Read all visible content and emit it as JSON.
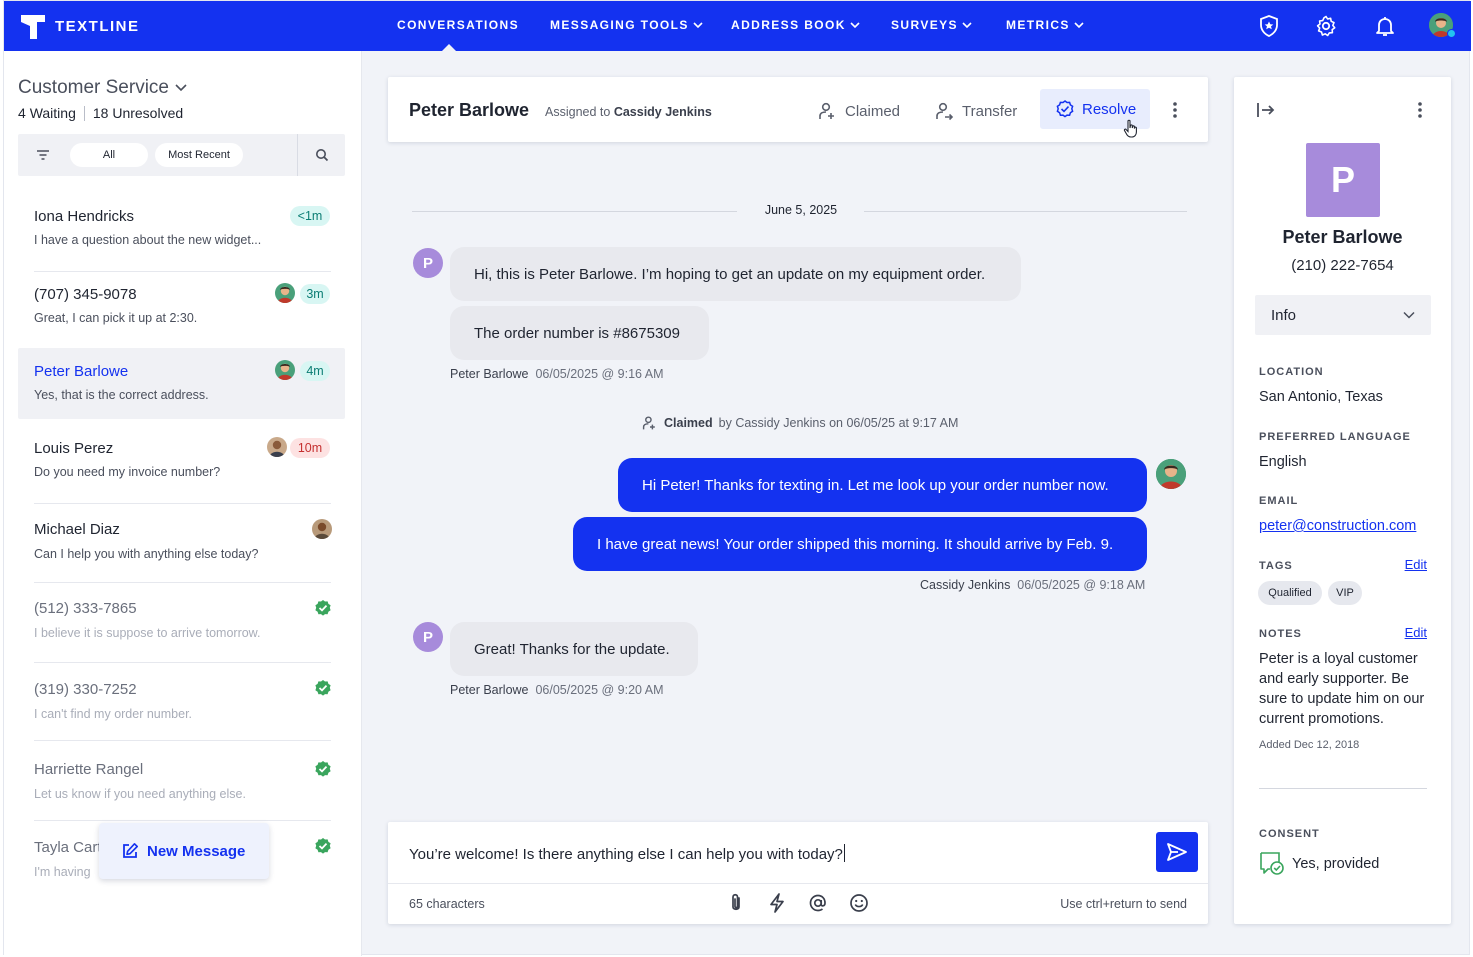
{
  "brand": {
    "name": "TEXTLINE",
    "brand_color": "#1432f0"
  },
  "nav": {
    "items": [
      {
        "label": "CONVERSATIONS",
        "active": true,
        "dropdown": false
      },
      {
        "label": "MESSAGING TOOLS",
        "dropdown": true
      },
      {
        "label": "ADDRESS BOOK",
        "dropdown": true
      },
      {
        "label": "SURVEYS",
        "dropdown": true
      },
      {
        "label": "METRICS",
        "dropdown": true
      }
    ],
    "icons": [
      "shield-star-icon",
      "gear-icon",
      "bell-icon",
      "user-avatar"
    ]
  },
  "sidebar": {
    "department": "Customer Service",
    "waiting_count": "4",
    "waiting_label": "Waiting",
    "unresolved_count": "18",
    "unresolved_label": "Unresolved",
    "filters": {
      "all": "All",
      "sort": "Most Recent"
    },
    "conversations": [
      {
        "name": "Iona Hendricks",
        "preview": "I have a question about the new widget...",
        "time": "<1m",
        "badge": "teal"
      },
      {
        "name": "(707) 345-9078",
        "preview": "Great, I can pick it up at 2:30.",
        "time": "3m",
        "badge": "teal",
        "avatar": true
      },
      {
        "name": "Peter Barlowe",
        "preview": "Yes, that is the correct address.",
        "time": "4m",
        "badge": "teal",
        "avatar": true,
        "selected": true
      },
      {
        "name": "Louis Perez",
        "preview": "Do you need my invoice number?",
        "time": "10m",
        "badge": "red",
        "avatar": true
      },
      {
        "name": "Michael Diaz",
        "preview": "Can I help you with anything else today?",
        "avatar": true
      },
      {
        "name": "(512) 333-7865",
        "preview": "I believe it is suppose to arrive tomorrow.",
        "resolved": true
      },
      {
        "name": "(319) 330-7252",
        "preview": "I can't find my order number.",
        "resolved": true
      },
      {
        "name": "Harriette Rangel",
        "preview": "Let us know if you need anything else.",
        "resolved": true
      },
      {
        "name": "Tayla Carter",
        "preview": "I'm having",
        "resolved": true
      }
    ],
    "new_message": "New Message"
  },
  "conversation": {
    "contact_name": "Peter Barlowe",
    "assigned_prefix": "Assigned to",
    "assigned_to": "Cassidy Jenkins",
    "actions": {
      "claimed": "Claimed",
      "transfer": "Transfer",
      "resolve": "Resolve"
    },
    "date": "June 5, 2025",
    "messages": [
      {
        "text": "Hi, this is Peter Barlowe. I’m hoping to get an update on my equipment order."
      },
      {
        "text": "The order number is #8675309"
      },
      {
        "text": "Hi Peter! Thanks for texting in. Let me look up your order number now."
      },
      {
        "text": "I have great news! Your order shipped this morning. It should arrive by Feb. 9."
      },
      {
        "text": "Great! Thanks for the update."
      }
    ],
    "meta": [
      {
        "sender": "Peter Barlowe",
        "time": "06/05/2025 @ 9:16 AM"
      },
      {
        "sender": "Cassidy Jenkins",
        "time": "06/05/2025 @ 9:18 AM"
      },
      {
        "sender": "Peter Barlowe",
        "time": "06/05/2025 @ 9:20 AM"
      }
    ],
    "event": {
      "action": "Claimed",
      "rest": "by Cassidy Jenkins on 06/05/25 at 9:17 AM"
    },
    "avatar_letter": "P"
  },
  "composer": {
    "text": "You’re welcome! Is there anything else I can help you with today?",
    "char_count": "65 characters",
    "hint": "Use ctrl+return to send"
  },
  "contact": {
    "initial": "P",
    "name": "Peter Barlowe",
    "phone": "(210) 222-7654",
    "section": "Info",
    "location_label": "LOCATION",
    "location": "San Antonio, Texas",
    "language_label": "PREFERRED LANGUAGE",
    "language": "English",
    "email_label": "EMAIL",
    "email": "peter@construction.com",
    "tags_label": "TAGS",
    "tags": [
      "Qualified",
      "VIP"
    ],
    "edit": "Edit",
    "notes_label": "NOTES",
    "notes": "Peter is a loyal customer and early supporter. Be sure to update him on our current promotions.",
    "notes_added": "Added Dec 12, 2018",
    "consent_label": "CONSENT",
    "consent": "Yes, provided"
  }
}
